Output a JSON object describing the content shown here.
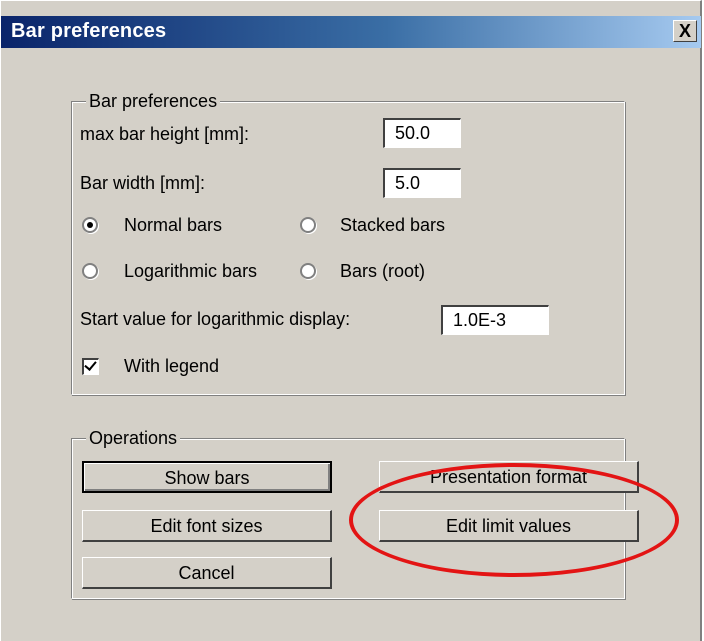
{
  "window": {
    "title": "Bar preferences",
    "close_label": "X"
  },
  "bar_group": {
    "legend": "Bar preferences",
    "max_height_label": "max bar height [mm]:",
    "max_height_value": "50.0",
    "width_label": "Bar width [mm]:",
    "width_value": "5.0",
    "radio_normal": "Normal bars",
    "radio_stacked": "Stacked bars",
    "radio_log": "Logarithmic bars",
    "radio_root": "Bars (root)",
    "selected_display": "Normal bars",
    "start_value_label": "Start value for logarithmic display:",
    "start_value": "1.0E-3",
    "legend_checkbox_label": "With legend",
    "legend_checked": true
  },
  "operations": {
    "legend": "Operations",
    "show_bars": "Show bars",
    "presentation_format": "Presentation format",
    "edit_font_sizes": "Edit font sizes",
    "edit_limit_values": "Edit limit values",
    "cancel": "Cancel"
  },
  "colors": {
    "dialog_bg": "#d4d0c8",
    "titlebar_start": "#0a246a",
    "titlebar_end": "#a6caf0",
    "highlight": "#e31414"
  }
}
